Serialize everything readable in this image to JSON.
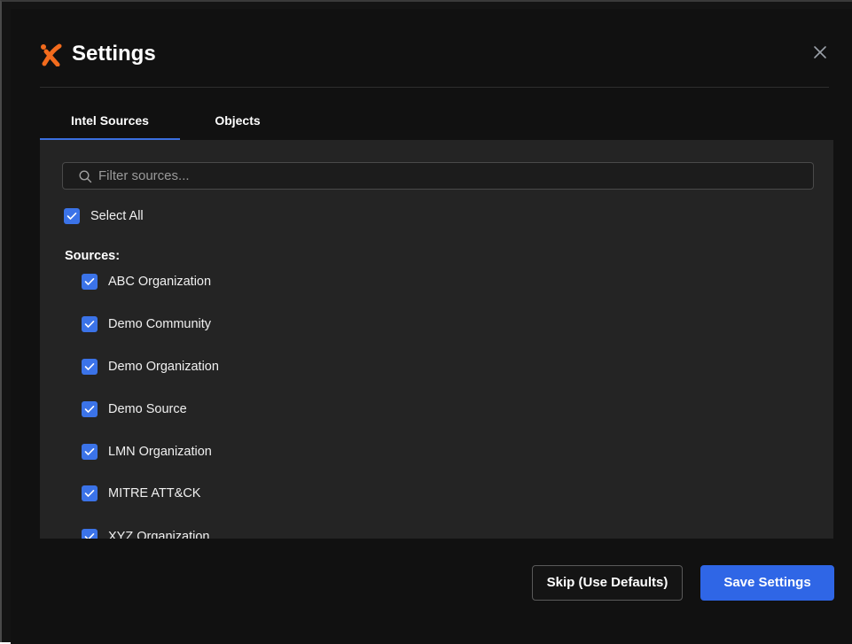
{
  "dialog": {
    "title": "Settings",
    "accent_color": "#f26b1d",
    "close_icon": "close-icon"
  },
  "tabs": [
    {
      "label": "Intel Sources",
      "active": true
    },
    {
      "label": "Objects",
      "active": false
    }
  ],
  "filter": {
    "placeholder": "Filter sources...",
    "value": ""
  },
  "select_all": {
    "label": "Select All",
    "checked": true
  },
  "sources": {
    "heading": "Sources:",
    "items": [
      {
        "label": "ABC Organization",
        "checked": true
      },
      {
        "label": "Demo Community",
        "checked": true
      },
      {
        "label": "Demo Organization",
        "checked": true
      },
      {
        "label": "Demo Source",
        "checked": true
      },
      {
        "label": "LMN Organization",
        "checked": true
      },
      {
        "label": "MITRE ATT&CK",
        "checked": true
      },
      {
        "label": "XYZ Organization",
        "checked": true
      }
    ]
  },
  "footer": {
    "skip_label": "Skip (Use Defaults)",
    "save_label": "Save Settings"
  },
  "colors": {
    "checkbox": "#3b73e8",
    "primary_button": "#2f66e6",
    "tab_indicator": "#3b6fe0",
    "panel_bg": "#242424",
    "modal_bg": "#111111"
  }
}
